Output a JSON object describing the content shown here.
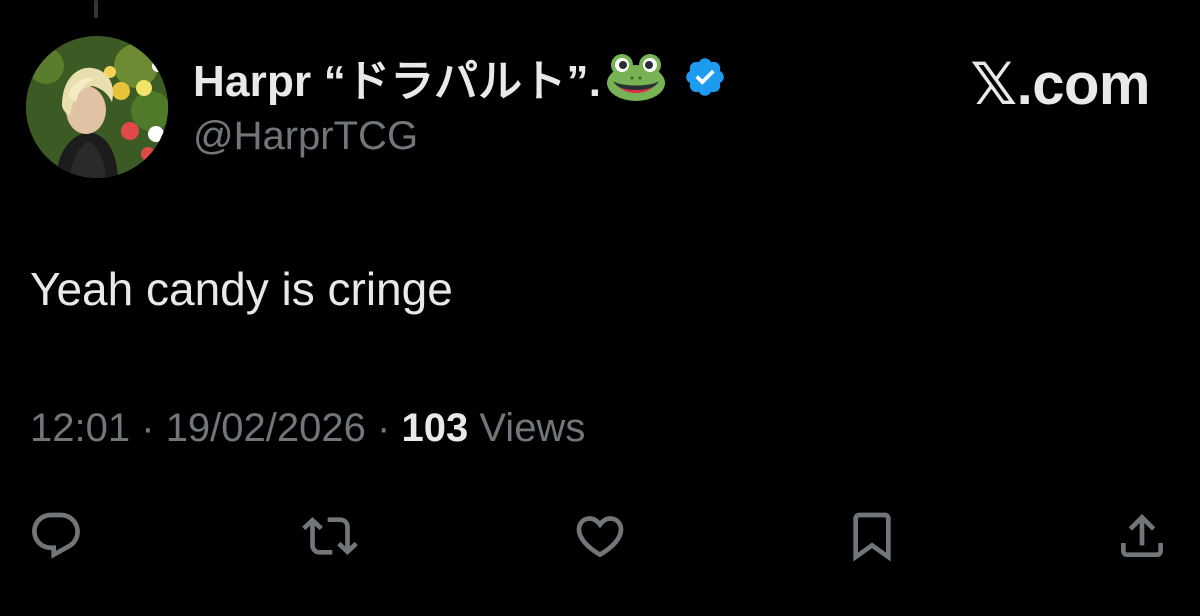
{
  "author": {
    "display_name": "Harpr “ドラパルト”.",
    "handle": "@HarprTCG",
    "verified": true,
    "name_emoji": "frog-icon"
  },
  "brand": {
    "label": "𝕏.com"
  },
  "tweet": {
    "text": "Yeah candy is cringe",
    "time": "12:01",
    "separator": "·",
    "date": "19/02/2026",
    "views_count": "103",
    "views_label": "Views"
  },
  "actions": {
    "icons": [
      "reply-icon",
      "retweet-icon",
      "like-icon",
      "bookmark-icon",
      "share-icon"
    ]
  },
  "colors": {
    "background": "#000000",
    "text_primary": "#e7e9ea",
    "text_secondary": "#71767b",
    "verified_blue": "#1d9bf0"
  }
}
